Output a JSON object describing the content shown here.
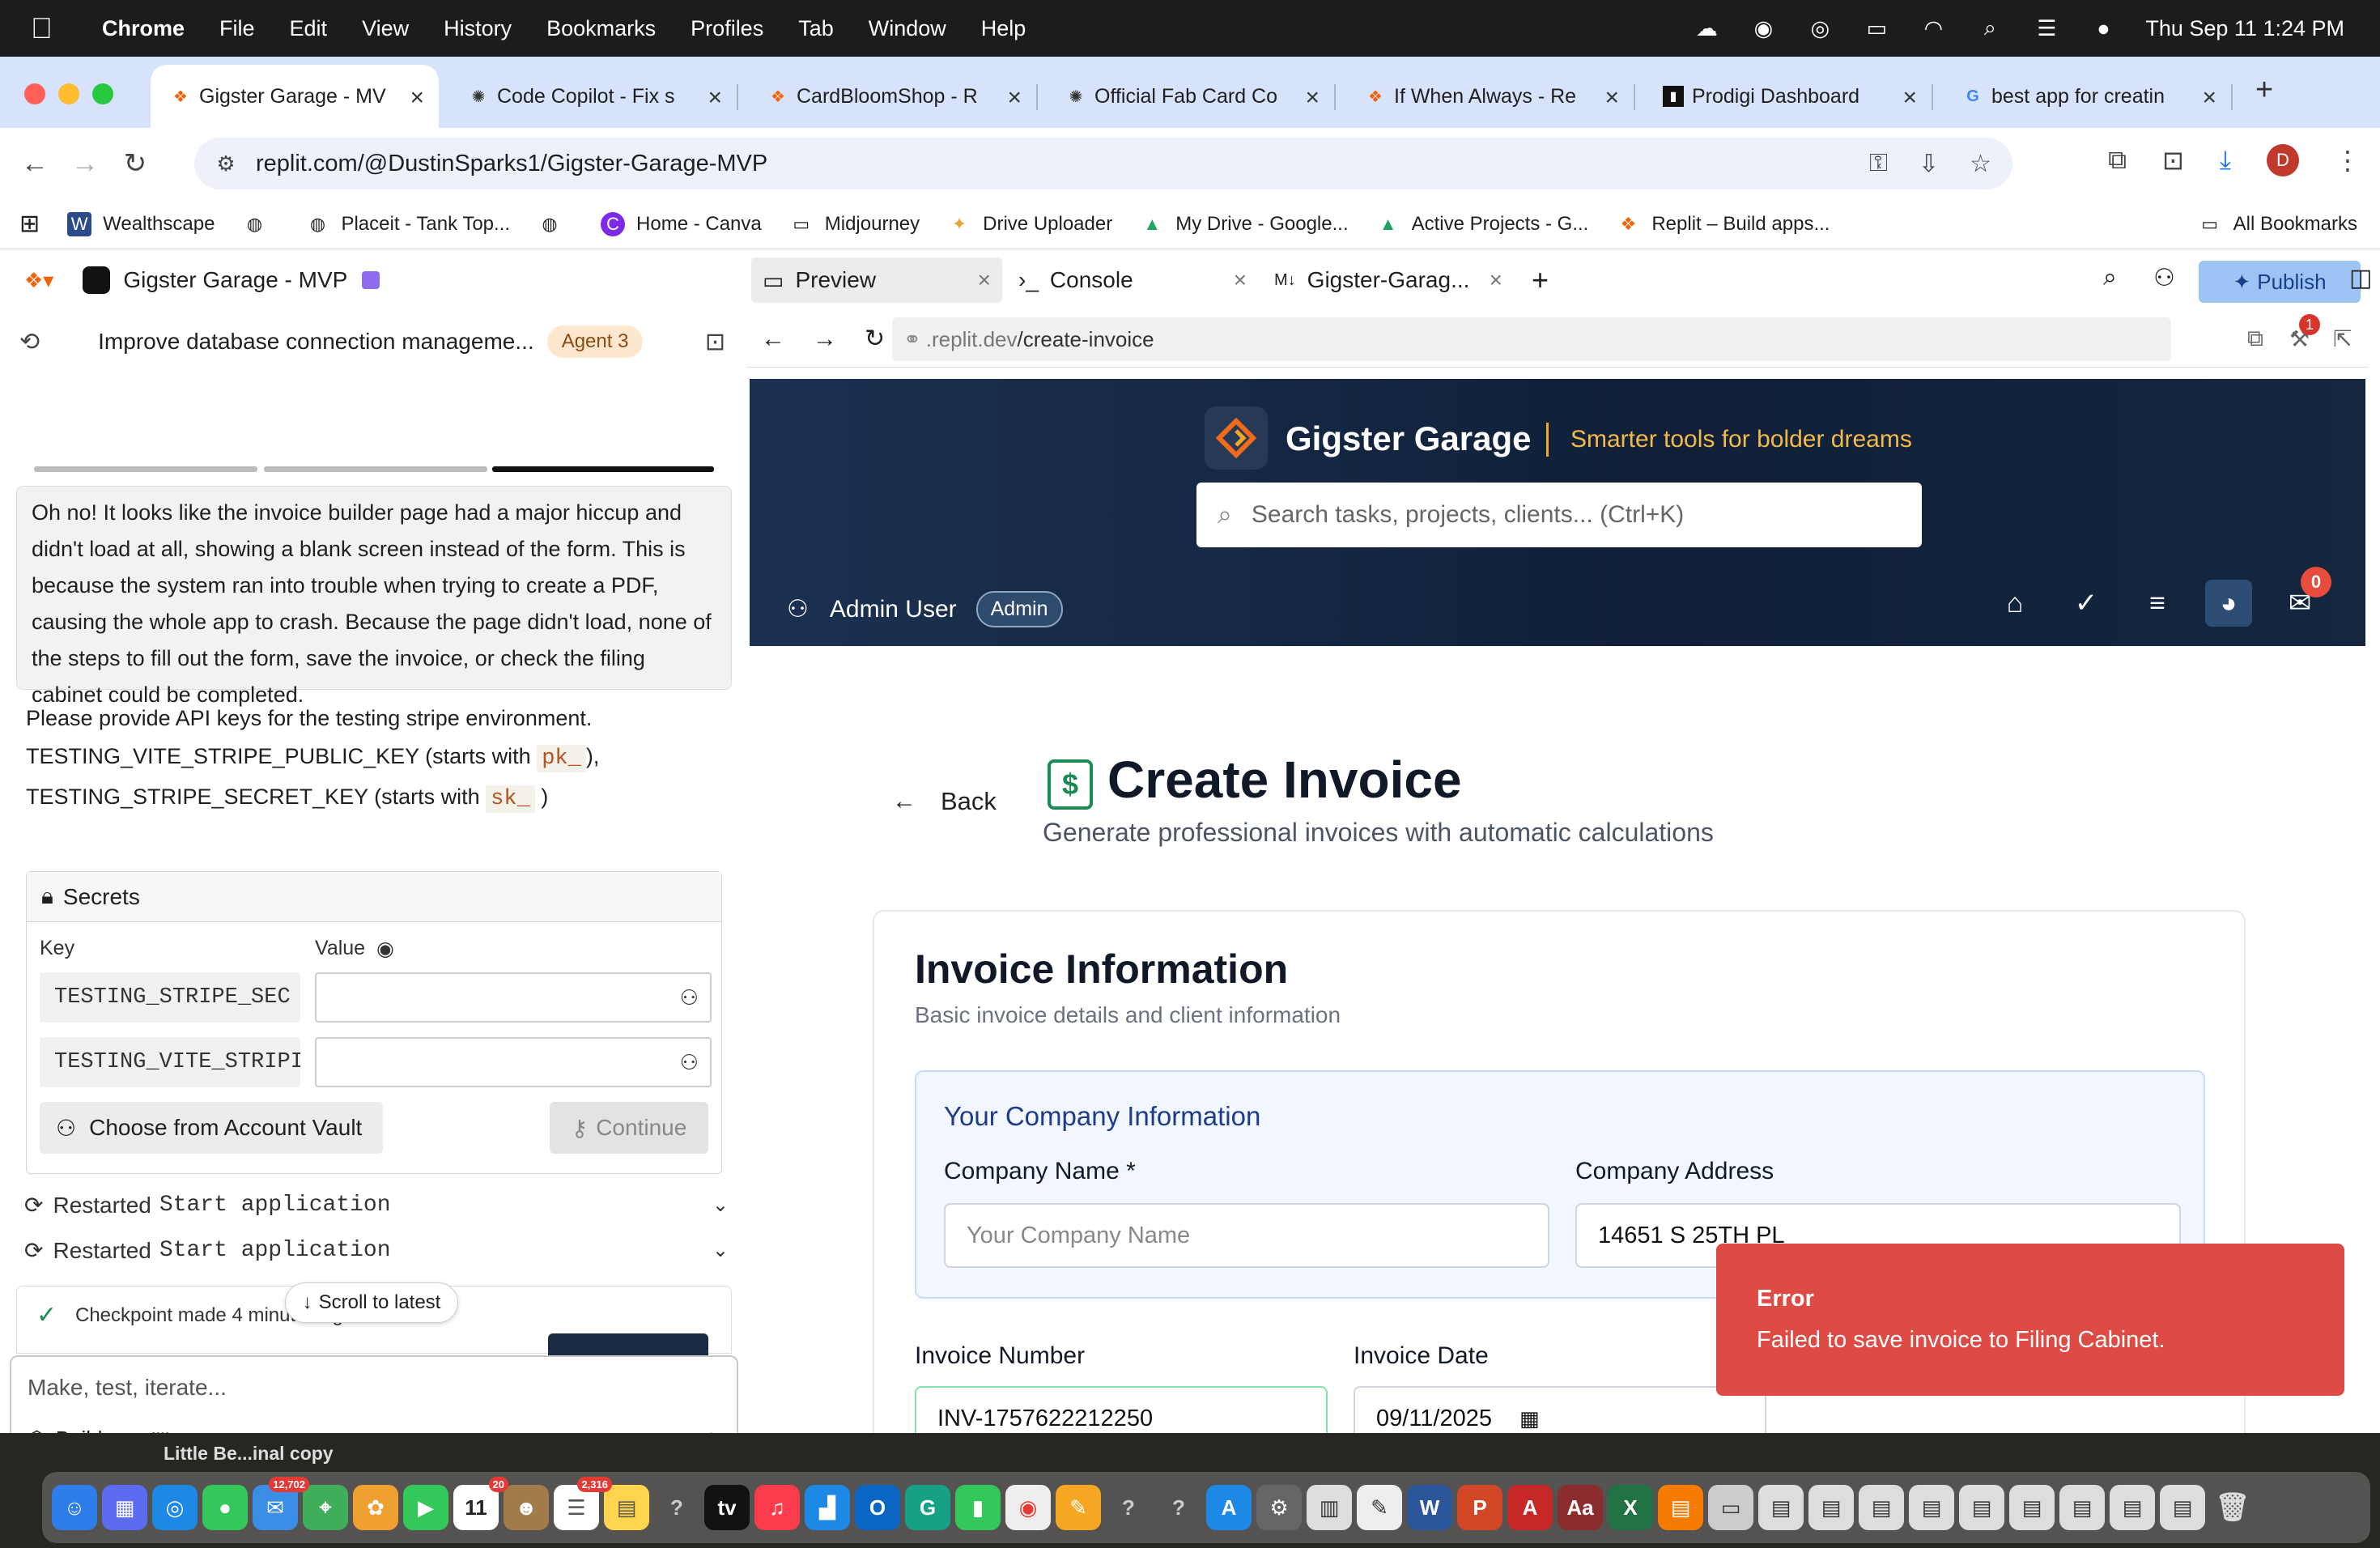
{
  "menubar": {
    "app_name": "Chrome",
    "items": [
      "File",
      "Edit",
      "View",
      "History",
      "Bookmarks",
      "Profiles",
      "Tab",
      "Window",
      "Help"
    ],
    "datetime": "Thu Sep 11  1:24 PM"
  },
  "browser": {
    "tabs": [
      {
        "title": "Gigster Garage - MVP",
        "icon": "replit-icon",
        "color": "#f26207"
      },
      {
        "title": "Code Copilot - Fix s",
        "icon": "openai-icon",
        "color": "#333333"
      },
      {
        "title": "CardBloomShop - R",
        "icon": "replit-icon",
        "color": "#f26207"
      },
      {
        "title": "Official Fab Card Co",
        "icon": "openai-icon",
        "color": "#333333"
      },
      {
        "title": "If When Always - Re",
        "icon": "replit-icon",
        "color": "#f26207"
      },
      {
        "title": "Prodigi Dashboard",
        "icon": "prodigi-icon",
        "color": "#111111"
      },
      {
        "title": "best app for creatin",
        "icon": "google-icon",
        "color": "#4285f4"
      }
    ],
    "url": "replit.com/@DustinSparks1/Gigster-Garage-MVP",
    "profile_initial": "D",
    "bookmarks": [
      {
        "label": "Wealthscape",
        "icon": "W",
        "color": "#2c4a8a"
      },
      {
        "label": "",
        "icon": "◍",
        "color": "#555555"
      },
      {
        "label": "Placeit - Tank Top...",
        "icon": "◍",
        "color": "#555555"
      },
      {
        "label": "",
        "icon": "◍",
        "color": "#555555"
      },
      {
        "label": "Home - Canva",
        "icon": "C",
        "color": "#7d2ae8"
      },
      {
        "label": "Midjourney",
        "icon": "▭",
        "color": "#555555"
      },
      {
        "label": "Drive Uploader",
        "icon": "✦",
        "color": "#e9a23b"
      },
      {
        "label": "My Drive - Google...",
        "icon": "▲",
        "color": "#1fa463"
      },
      {
        "label": "Active Projects - G...",
        "icon": "▲",
        "color": "#1fa463"
      },
      {
        "label": "Replit – Build apps...",
        "icon": "❖",
        "color": "#f26207"
      }
    ],
    "all_bookmarks": "All Bookmarks"
  },
  "replit": {
    "project_name": "Gigster Garage - MVP",
    "chat_title": "Improve database connection manageme...",
    "agent_badge": "Agent 3",
    "agent_message": "Oh no! It looks like the invoice builder page had a major hiccup and didn't load at all, showing a blank screen instead of the form. This is because the system ran into trouble when trying to create a PDF, causing the whole app to crash. Because the page didn't load, none of the steps to fill out the form, save the invoice, or check the filing cabinet could be completed.",
    "api_line1": "Please provide API keys for the testing stripe environment.",
    "api_key1_prefix": "TESTING_VITE_STRIPE_PUBLIC_KEY (starts with",
    "api_key1_code": "pk_",
    "api_key1_suffix": ")",
    "api_key2_prefix": "TESTING_STRIPE_SECRET_KEY (starts with",
    "api_key2_code": "sk_",
    "api_key2_suffix": ")",
    "secrets_title": "Secrets",
    "key_header": "Key",
    "value_header": "Value",
    "secret_keys": [
      "TESTING_STRIPE_SEC",
      "TESTING_VITE_STRIPI"
    ],
    "vault_button": "Choose from Account Vault",
    "continue_button": "Continue",
    "restarted_label": "Restarted",
    "restarted_cmd": "Start application",
    "checkpoint": "Checkpoint made 4 minutes ago",
    "scroll_latest": "Scroll to latest",
    "input_placeholder": "Make, test, iterate...",
    "build_label": "Build",
    "workspace_tabs": [
      "Preview",
      "Console",
      "Gigster-Garag..."
    ],
    "publish_label": "Publish",
    "preview_url_prefix": ".replit.dev",
    "preview_url_path": "/create-invoice",
    "notification_count": "1"
  },
  "app": {
    "brand": "Gigster Garage",
    "tagline": "Smarter tools for bolder dreams",
    "search_placeholder": "Search tasks, projects, clients... (Ctrl+K)",
    "user_name": "Admin User",
    "user_role": "Admin",
    "mail_count": "0",
    "back_label": "Back",
    "page_title": "Create Invoice",
    "page_subtitle": "Generate professional invoices with automatic calculations",
    "card_title": "Invoice Information",
    "card_subtitle": "Basic invoice details and client information",
    "company_section": "Your Company Information",
    "company_name_label": "Company Name *",
    "company_name_placeholder": "Your Company Name",
    "company_address_label": "Company Address",
    "company_address_value": "14651 S 25TH PL",
    "invoice_number_label": "Invoice Number",
    "invoice_number_value": "INV-1757622212250",
    "invoice_date_label": "Invoice Date",
    "invoice_date_value": "09/11/2025"
  },
  "toast": {
    "title": "Error",
    "message": "Failed to save invoice to Filing Cabinet."
  },
  "dock": {
    "label": "Little Be...inal copy",
    "mail_badge": "12,702",
    "calendar_day": "11",
    "calendar_badge": "20",
    "reminders_badge": "2,316"
  }
}
